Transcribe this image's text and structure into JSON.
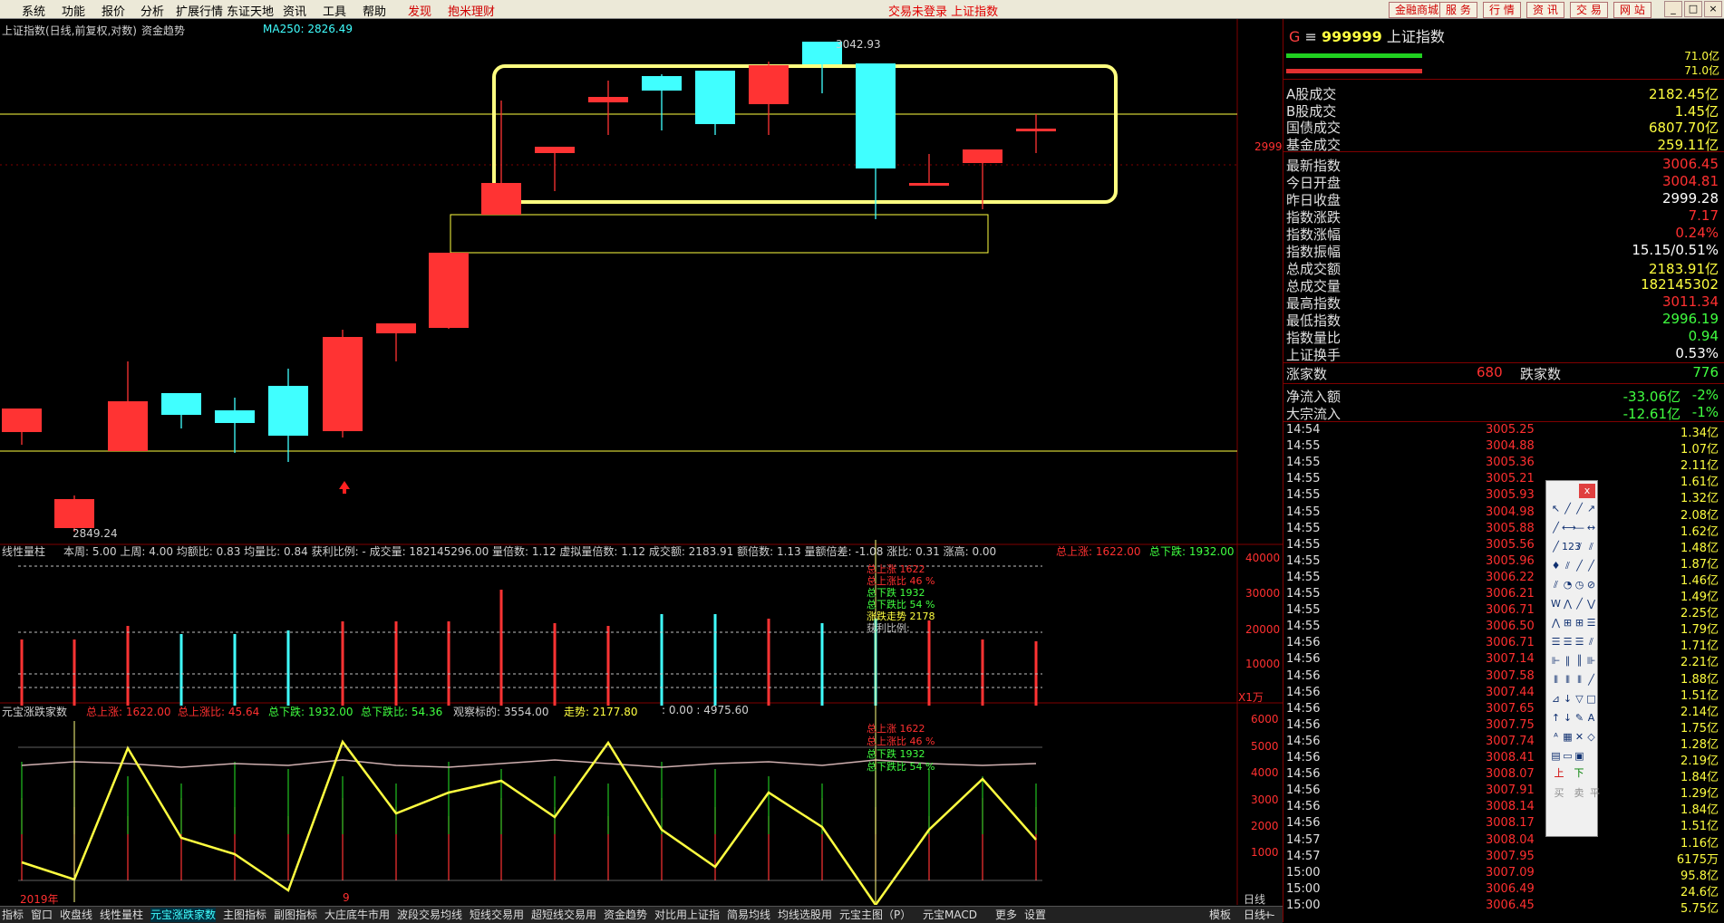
{
  "menu": {
    "items": [
      "系统",
      "功能",
      "报价",
      "分析",
      "扩展行情",
      "东证天地",
      "资讯",
      "工具",
      "帮助"
    ],
    "discover": "发现",
    "wealth": "抱米理财",
    "status": "交易未登录  上证指数",
    "right_buttons": [
      "金融商城",
      "服 务",
      "行 情",
      "资 讯",
      "交 易",
      "网 站"
    ]
  },
  "chart_header": {
    "title": "上证指数(日线,前复权,对数)",
    "fund_trend": "资金趋势",
    "ma250": "MA250: 2826.49",
    "high_label": "3042.93",
    "low_label": "2849.24",
    "price_tick": "2999"
  },
  "vol_header": {
    "name": "线性量柱",
    "fields": "本周: 5.00  上周: 4.00  均额比: 0.83  均量比: 0.84  获利比例: -  成交量: 182145296.00  量倍数: 1.12  虚拟量倍数: 1.12  成交额: 2183.91  额倍数: 1.13  量额倍差: -1.08  涨比: 0.31  涨高: 0.00",
    "total_up": "总上涨: 1622.00",
    "total_down": "总下跌: 1932.00",
    "unit": "X1万",
    "axis": [
      "40000",
      "30000",
      "20000",
      "10000"
    ],
    "overlay": [
      "总上涨 1622",
      "总上涨比 46 %",
      "总下跌 1932",
      "总下跌比 54 %",
      "涨跌走势 2178",
      "获利比例:"
    ]
  },
  "breadth_header": {
    "name": "元宝涨跌家数",
    "total_up": "总上涨: 1622.00",
    "up_ratio": "总上涨比: 45.64",
    "total_down": "总下跌: 1932.00",
    "down_ratio": "总下跌比: 54.36",
    "observe": "观察标的: 3554.00",
    "trend": "走势: 2177.80",
    "extra": ": 0.00 : 4975.60",
    "axis": [
      "6000",
      "5000",
      "4000",
      "3000",
      "2000",
      "1000"
    ],
    "overlay": [
      "总上涨 1622",
      "总上涨比 46 %",
      "总下跌 1932",
      "总下跌比 54 %"
    ],
    "x_labels": [
      "2019年",
      "9"
    ],
    "period": "日线"
  },
  "quote": {
    "prefix": "G",
    "code": "999999",
    "name": "上证指数",
    "bar_values": [
      "71.0亿",
      "71.0亿"
    ],
    "rows1": [
      {
        "k": "A股成交",
        "v": "2182.45亿",
        "c": "#ffff40"
      },
      {
        "k": "B股成交",
        "v": "1.45亿",
        "c": "#ffff40"
      },
      {
        "k": "国债成交",
        "v": "6807.70亿",
        "c": "#ffff40"
      },
      {
        "k": "基金成交",
        "v": "259.11亿",
        "c": "#ffff40"
      }
    ],
    "rows2": [
      {
        "k": "最新指数",
        "v": "3006.45",
        "c": "#ff3030"
      },
      {
        "k": "今日开盘",
        "v": "3004.81",
        "c": "#ff3030"
      },
      {
        "k": "昨日收盘",
        "v": "2999.28",
        "c": "#ffffff"
      },
      {
        "k": "指数涨跌",
        "v": "7.17",
        "c": "#ff3030"
      },
      {
        "k": "指数涨幅",
        "v": "0.24%",
        "c": "#ff3030"
      },
      {
        "k": "指数振幅",
        "v": "15.15/0.51%",
        "c": "#ffffff"
      },
      {
        "k": "总成交额",
        "v": "2183.91亿",
        "c": "#ffff40"
      },
      {
        "k": "总成交量",
        "v": "182145302",
        "c": "#ffff40"
      },
      {
        "k": "最高指数",
        "v": "3011.34",
        "c": "#ff3030"
      },
      {
        "k": "最低指数",
        "v": "2996.19",
        "c": "#40ff40"
      },
      {
        "k": "指数量比",
        "v": "0.94",
        "c": "#40ff40"
      },
      {
        "k": "上证换手",
        "v": "0.53%",
        "c": "#ffffff"
      }
    ],
    "up_label": "涨家数",
    "up_count": "680",
    "down_label": "跌家数",
    "down_count": "776",
    "inflow": [
      {
        "k": "净流入额",
        "v": "-33.06亿",
        "p": "-2%"
      },
      {
        "k": "大宗流入",
        "v": "-12.61亿",
        "p": "-1%"
      }
    ],
    "ticks": [
      [
        "14:54",
        "3005.25",
        "1.34亿"
      ],
      [
        "14:55",
        "3004.88",
        "1.07亿"
      ],
      [
        "14:55",
        "3005.36",
        "2.11亿"
      ],
      [
        "14:55",
        "3005.21",
        "1.61亿"
      ],
      [
        "14:55",
        "3005.93",
        "1.32亿"
      ],
      [
        "14:55",
        "3004.98",
        "2.08亿"
      ],
      [
        "14:55",
        "3005.88",
        "1.62亿"
      ],
      [
        "14:55",
        "3005.56",
        "1.48亿"
      ],
      [
        "14:55",
        "3005.96",
        "1.87亿"
      ],
      [
        "14:55",
        "3006.22",
        "1.46亿"
      ],
      [
        "14:55",
        "3006.21",
        "1.49亿"
      ],
      [
        "14:55",
        "3006.71",
        "2.25亿"
      ],
      [
        "14:55",
        "3006.50",
        "1.79亿"
      ],
      [
        "14:56",
        "3006.71",
        "1.71亿"
      ],
      [
        "14:56",
        "3007.14",
        "2.21亿"
      ],
      [
        "14:56",
        "3007.58",
        "1.88亿"
      ],
      [
        "14:56",
        "3007.44",
        "1.51亿"
      ],
      [
        "14:56",
        "3007.65",
        "2.14亿"
      ],
      [
        "14:56",
        "3007.75",
        "1.75亿"
      ],
      [
        "14:56",
        "3007.74",
        "1.28亿"
      ],
      [
        "14:56",
        "3008.41",
        "2.19亿"
      ],
      [
        "14:56",
        "3008.07",
        "1.84亿"
      ],
      [
        "14:56",
        "3007.91",
        "1.29亿"
      ],
      [
        "14:56",
        "3008.14",
        "1.84亿"
      ],
      [
        "14:56",
        "3008.17",
        "1.51亿"
      ],
      [
        "14:57",
        "3008.04",
        "1.16亿"
      ],
      [
        "14:57",
        "3007.95",
        "6175万"
      ],
      [
        "15:00",
        "3007.09",
        "95.8亿"
      ],
      [
        "15:00",
        "3006.49",
        "24.6亿"
      ],
      [
        "15:00",
        "3006.45",
        "5.75亿"
      ]
    ]
  },
  "tabs": [
    "指标",
    "窗口",
    "收盘线",
    "线性量柱",
    "元宝涨跌家数",
    "主图指标",
    "副图指标",
    "大庄底牛市用",
    "波段交易均线",
    "短线交易用",
    "超短线交易用",
    "资金趋势",
    "对比用上证指",
    "简易均线",
    "均线选股用",
    "元宝主图（P）",
    "元宝MACD",
    "更多",
    "设置"
  ],
  "tabs_right": [
    "模板",
    "日线",
    "+",
    "-"
  ],
  "toolbox": {
    "close": "x",
    "bottom": [
      "上",
      "下",
      "买",
      "卖",
      "平"
    ]
  },
  "colors": {
    "up": "#ff3333",
    "down": "#40ffff",
    "yellow": "#ffff40",
    "green": "#40ff40"
  }
}
